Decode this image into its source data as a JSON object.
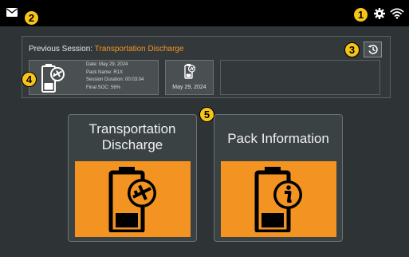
{
  "topbar": {
    "mail_icon": "envelope-icon",
    "settings_icon": "gear-icon",
    "wifi_icon": "wifi-icon"
  },
  "markers": [
    "1",
    "2",
    "3",
    "4",
    "5"
  ],
  "previous_session": {
    "prefix": "Previous Session: ",
    "name": "Transportation Discharge",
    "history_icon": "history-icon"
  },
  "selected_session": {
    "icon": "battery-plane-icon",
    "date": "Date: May 29, 2024",
    "pack_name": "Pack Name: R1X",
    "duration": "Session Duration: 00:03:04",
    "final_soc": "Final SOC: 56%"
  },
  "second_session": {
    "icon": "battery-plane-icon",
    "date": "May 29, 2024"
  },
  "tiles": [
    {
      "title_line1": "Transportation",
      "title_line2": "Discharge",
      "icon": "battery-plane-icon"
    },
    {
      "title_line1": "Pack Information",
      "title_line2": "",
      "icon": "battery-info-icon"
    }
  ],
  "colors": {
    "accent": "#f39321",
    "marker": "#f7c51a",
    "background": "#2e3335"
  }
}
